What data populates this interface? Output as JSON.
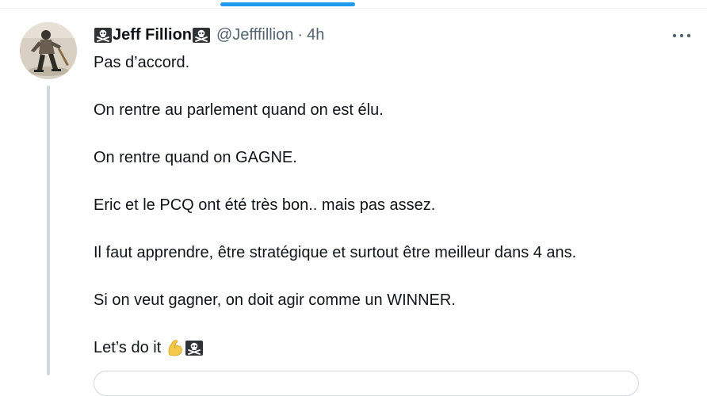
{
  "tweet": {
    "display_name": "Jeff Fillion",
    "handle": "@Jefffillion",
    "separator": "·",
    "timestamp": "4h",
    "lines": [
      "Pas d’accord.",
      "On rentre au parlement quand on est élu.",
      "On rentre quand on GAGNE.",
      "Eric et le PCQ ont été très bon.. mais pas assez.",
      "Il faut apprendre, être stratégique et surtout être meilleur dans 4 ans.",
      "Si on veut gagner, on doit agir comme un WINNER.",
      "Let’s do it"
    ],
    "name_emoji": "skull-and-crossbones",
    "closing_emojis": [
      "flexed-biceps",
      "skull-and-crossbones"
    ]
  },
  "colors": {
    "accent": "#1d9bf0",
    "text_primary": "#0f1419",
    "text_secondary": "#536471",
    "border": "#cfd9de"
  }
}
